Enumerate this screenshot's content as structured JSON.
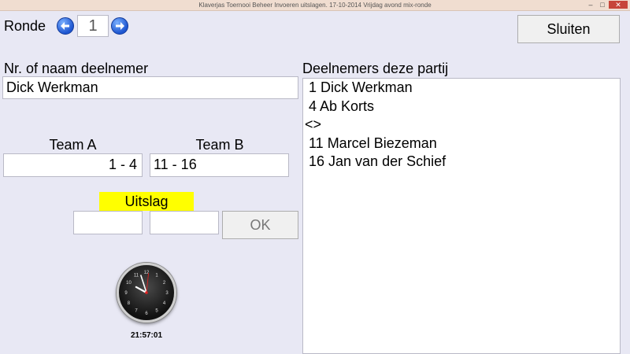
{
  "window": {
    "title": "Klaverjas Toernooi Beheer Invoeren uitslagen. 17-10-2014 Vrijdag avond mix-ronde",
    "min_glyph": "–",
    "max_glyph": "□",
    "close_glyph": "✕"
  },
  "round": {
    "label": "Ronde",
    "value": "1"
  },
  "close_button": "Sluiten",
  "participant": {
    "label": "Nr. of naam deelnemer",
    "value": "Dick Werkman"
  },
  "teams": {
    "a_label": "Team A",
    "a_value": "1 - 4",
    "b_label": "Team B",
    "b_value": "11 - 16"
  },
  "result": {
    "label": "Uitslag",
    "field_a": "",
    "field_b": "",
    "ok_label": "OK"
  },
  "list": {
    "label": "Deelnemers deze partij",
    "items": [
      " 1 Dick Werkman",
      " 4 Ab Korts",
      "<>",
      " 11 Marcel Biezeman",
      " 16 Jan van der Schief"
    ]
  },
  "clock": {
    "time": "21:57:01",
    "hour": 21,
    "minute": 57,
    "second": 1
  },
  "colors": {
    "background": "#e8e8f4",
    "uitslag_highlight": "#ffff00",
    "arrow_blue": "#1d55d0"
  }
}
